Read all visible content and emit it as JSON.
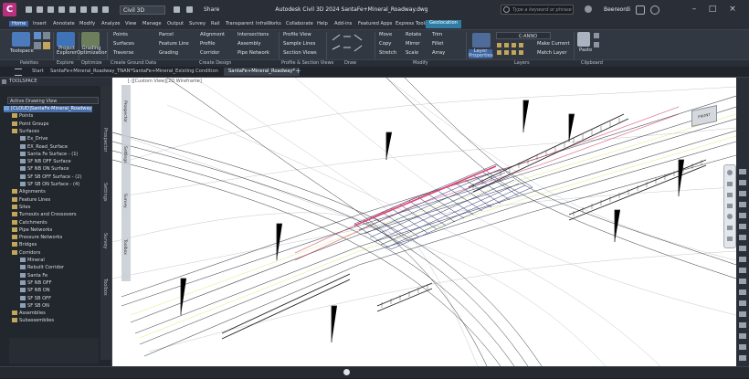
{
  "titlebar": {
    "workspace": "Civil 3D",
    "share": "Share",
    "doc_title": "Autodesk Civil 3D 2024   SantaFe+Mineral_Roadway.dwg",
    "search_placeholder": "Type a keyword or phrase",
    "user": "Beereordi"
  },
  "menu": [
    "Home",
    "Insert",
    "Annotate",
    "Modify",
    "Analyze",
    "View",
    "Manage",
    "Output",
    "Survey",
    "Rail",
    "Transparent",
    "InfraWorks",
    "Collaborate",
    "Help",
    "Add-ins",
    "Featured Apps",
    "Express Tools",
    "Geolocation"
  ],
  "ribbon": {
    "toolspace": "Toolspace",
    "project_explorer": "Project Explorer",
    "grading_opt": "Grading Optimization",
    "col1": [
      "Points",
      "Surfaces",
      "Traverse"
    ],
    "col2": [
      "Parcel",
      "Feature Line",
      "Grading"
    ],
    "col3": [
      "Alignment",
      "Profile",
      "Corridor"
    ],
    "col4": [
      "Intersections",
      "Assembly",
      "Pipe Network"
    ],
    "col5": [
      "Profile View",
      "Sample Lines",
      "Section Views"
    ],
    "modify1": [
      "Move",
      "Copy",
      "Stretch"
    ],
    "modify2": [
      "Rotate",
      "Mirror",
      "Scale"
    ],
    "modify3": [
      "Trim",
      "Fillet",
      "Array"
    ],
    "layer_prop": "Layer Properties",
    "layer_name": "C-ANNO",
    "layer_actions": [
      "Make Current",
      "Match Layer"
    ],
    "paste": "Paste",
    "panels": [
      "Palettes",
      "Explore",
      "Optimize",
      "Create Ground Data",
      "Create Design",
      "Profile & Section Views",
      "Draw",
      "Modify",
      "Layers",
      "Clipboard"
    ]
  },
  "file_tabs": [
    "Start",
    "SantaFe+Mineral_Roadway_TNAN*",
    "SantaFe+Mineral_Existing Condition",
    "SantaFe+Mineral_Roadway*"
  ],
  "toolspace": {
    "header": "TOOLSPACE",
    "view": "Active Drawing View",
    "tabs": [
      "Prospector",
      "Settings",
      "Survey",
      "Toolbox"
    ],
    "tree": [
      {
        "label": "[CLOUD]SantaFe-Mineral_Roadway",
        "level": 1,
        "selected": true
      },
      {
        "label": "Points",
        "level": 2
      },
      {
        "label": "Point Groups",
        "level": 2
      },
      {
        "label": "Surfaces",
        "level": 2
      },
      {
        "label": "Ex_Drive",
        "level": 3
      },
      {
        "label": "EX_Road_Surface",
        "level": 3
      },
      {
        "label": "Santa Fe Surface - (1)",
        "level": 3
      },
      {
        "label": "SF NB OFF Surface",
        "level": 3
      },
      {
        "label": "SF NB ON Surface",
        "level": 3
      },
      {
        "label": "SF SB OFF Surface - (2)",
        "level": 3
      },
      {
        "label": "SF SB ON Surface - (4)",
        "level": 3
      },
      {
        "label": "Alignments",
        "level": 2
      },
      {
        "label": "Feature Lines",
        "level": 2
      },
      {
        "label": "Sites",
        "level": 2
      },
      {
        "label": "Turnouts and Crossovers",
        "level": 2
      },
      {
        "label": "Catchments",
        "level": 2
      },
      {
        "label": "Pipe Networks",
        "level": 2
      },
      {
        "label": "Pressure Networks",
        "level": 2
      },
      {
        "label": "Bridges",
        "level": 2
      },
      {
        "label": "Corridors",
        "level": 2
      },
      {
        "label": "Mineral",
        "level": 3
      },
      {
        "label": "Rebuilt Corridor",
        "level": 3
      },
      {
        "label": "Santa Fe",
        "level": 3
      },
      {
        "label": "SF NB OFF",
        "level": 3
      },
      {
        "label": "SF NB ON",
        "level": 3
      },
      {
        "label": "SF SB OFF",
        "level": 3
      },
      {
        "label": "SF SB ON",
        "level": 3
      },
      {
        "label": "Assemblies",
        "level": 2
      },
      {
        "label": "Subassemblies",
        "level": 2
      }
    ]
  },
  "viewport": {
    "label": "[-][Custom View][2D Wireframe]",
    "cad_tabs": [
      "Prospector",
      "Settings",
      "Survey",
      "Toolbox"
    ],
    "viewcube": "FRONT"
  },
  "colors": {
    "accent": "#3c66a5",
    "context_tab": "#2f7da5",
    "app_logo": "#b8317f"
  }
}
